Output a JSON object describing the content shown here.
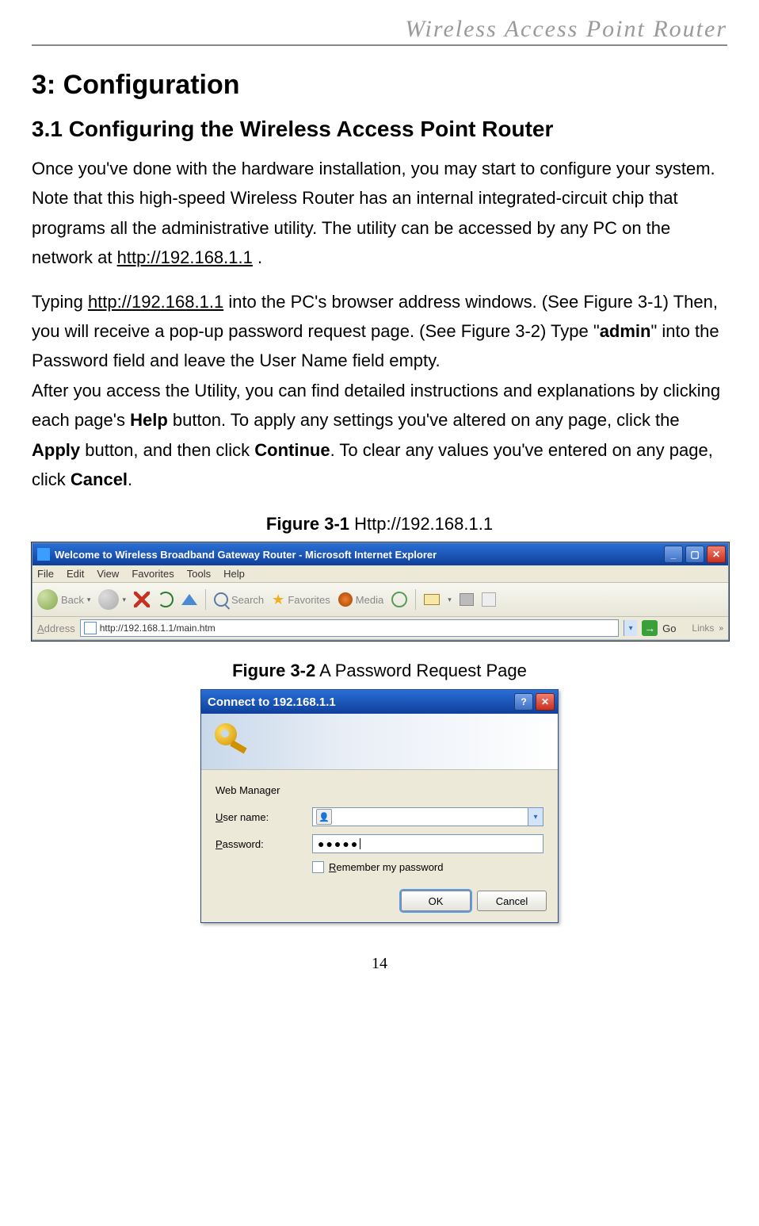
{
  "header": {
    "running_title": "Wireless  Access  Point  Router"
  },
  "headings": {
    "h1": "3: Configuration",
    "h2": "3.1 Configuring the Wireless Access Point Router"
  },
  "paragraphs": {
    "p1a": "Once you've done with the hardware installation, you may start to configure your system. Note that this high-speed Wireless Router has an internal integrated-circuit chip that programs all the administrative utility. The utility can be accessed by any PC on the network at ",
    "p1_link": "http://192.168.1.1",
    "p1b": " .",
    "p2a": "Typing ",
    "p2_link": "http://192.168.1.1",
    "p2b": " into the PC's browser address windows. (See Figure 3-1) Then, you will receive a pop-up password request page. (See Figure 3-2) Type \"",
    "p2_admin": "admin",
    "p2c": "\" into the Password field and leave the User Name field empty.",
    "p3a": "After you access the Utility, you can find detailed instructions and explanations by clicking each page's ",
    "p3_help": "Help",
    "p3b": " button. To apply any settings you've altered on any page, click the ",
    "p3_apply": "Apply",
    "p3c": " button, and then click ",
    "p3_continue": "Continue",
    "p3d": ". To clear any values you've entered on any page, click ",
    "p3_cancel": "Cancel",
    "p3e": "."
  },
  "figures": {
    "f1_label": "Figure 3-1",
    "f1_text": " Http://192.168.1.1",
    "f2_label": "Figure 3-2",
    "f2_text": " A Password Request Page"
  },
  "browser": {
    "title": "Welcome to Wireless Broadband Gateway Router - Microsoft Internet Explorer",
    "menus": [
      "File",
      "Edit",
      "View",
      "Favorites",
      "Tools",
      "Help"
    ],
    "back": "Back",
    "search": "Search",
    "favorites": "Favorites",
    "media": "Media",
    "address_label": "Address",
    "address_value": "http://192.168.1.1/main.htm",
    "go": "Go",
    "links": "Links"
  },
  "dialog": {
    "title": "Connect to 192.168.1.1",
    "realm": "Web Manager",
    "user_label": "User name:",
    "pass_label": "Password:",
    "pass_value": "●●●●●",
    "remember": "Remember my password",
    "ok": "OK",
    "cancel": "Cancel"
  },
  "page_number": "14"
}
